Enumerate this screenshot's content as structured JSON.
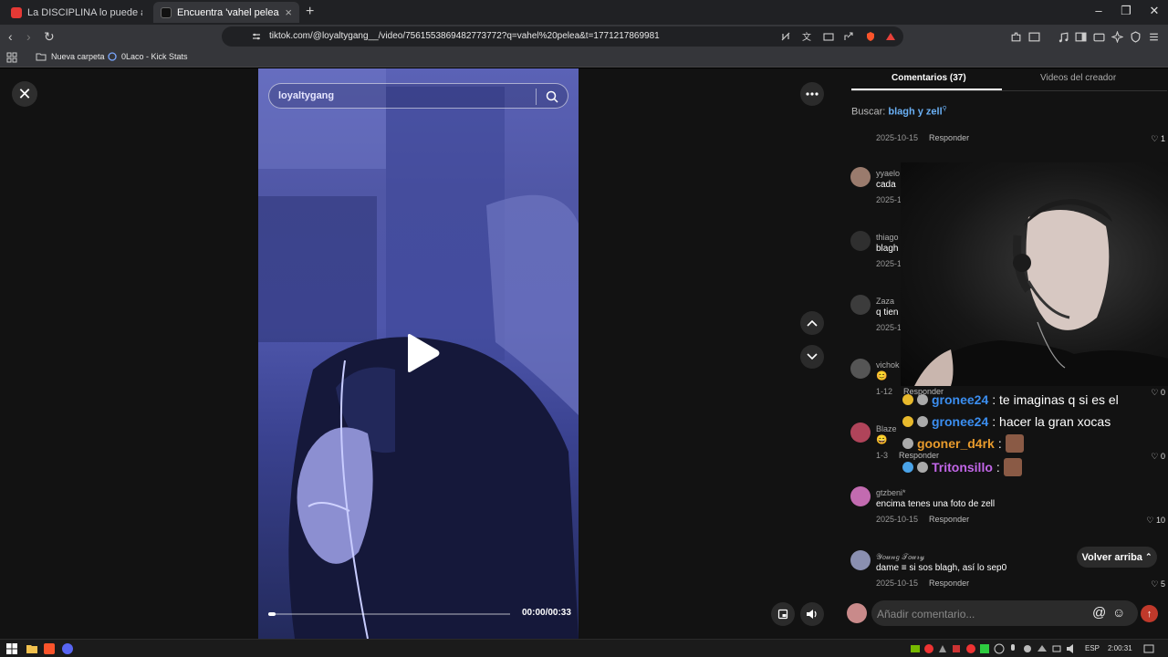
{
  "browser": {
    "tabs": [
      {
        "label": "La DISCIPLINA lo puede a TODO - El",
        "active": false
      },
      {
        "label": "Encuentra 'vahel pelea' en TikTok",
        "active": true
      }
    ],
    "url": "tiktok.com/@loyaltygang__/video/7561553869482773772?q=vahel%20pelea&t=1771217869981",
    "bookmarks": [
      "Nueva carpeta",
      "0Laco - Kick Stats"
    ]
  },
  "video": {
    "search_value": "loyaltygang",
    "time": "00:00/00:33",
    "progress_fraction": 0.0
  },
  "panel": {
    "tabs": [
      "Comentarios (37)",
      "Videos del creador"
    ],
    "search_prefix": "Buscar:",
    "search_term": "blagh y zell",
    "reply_label": "Responder",
    "comments": [
      {
        "name": "",
        "text": "",
        "date": "2025-10-15",
        "likes": "1"
      },
      {
        "name": "yyaelo",
        "text": "cada",
        "date": "2025-1",
        "likes": ""
      },
      {
        "name": "thiago",
        "text": "blagh",
        "date": "2025-1",
        "likes": ""
      },
      {
        "name": "Zaza",
        "text": "q tien",
        "date": "2025-1",
        "likes": ""
      },
      {
        "name": "vichok",
        "text": "😊",
        "date": "1-12",
        "likes": "0"
      },
      {
        "name": "Blaze",
        "text": "😄",
        "date": "1-3",
        "likes": "0"
      },
      {
        "name": "gtzbeni*",
        "text": "encima tenes una foto de zell",
        "date": "2025-10-15",
        "likes": "10"
      },
      {
        "name": "𝒴𝑜𝓊𝓃𝑔 𝒯𝑜𝓊𝓇𝓎",
        "text": "dame ≡ si sos blagh, así lo sep0",
        "date": "2025-10-15",
        "likes": "5"
      }
    ],
    "back_to_top": "Volver arriba",
    "composer_placeholder": "Añadir comentario..."
  },
  "overlay_chat": [
    {
      "user": "gronee24",
      "message": ": te imaginas q si es el",
      "color": "#3b8ef0"
    },
    {
      "user": "gronee24",
      "message": ": hacer la gran xocas",
      "color": "#3b8ef0"
    },
    {
      "user": "gooner_d4rk",
      "message": ":",
      "color": "#e89b2c"
    },
    {
      "user": "Tritonsillo",
      "message": ":",
      "color": "#c266e8"
    }
  ],
  "taskbar": {
    "language": "ESP",
    "clock": "2:00:31"
  }
}
